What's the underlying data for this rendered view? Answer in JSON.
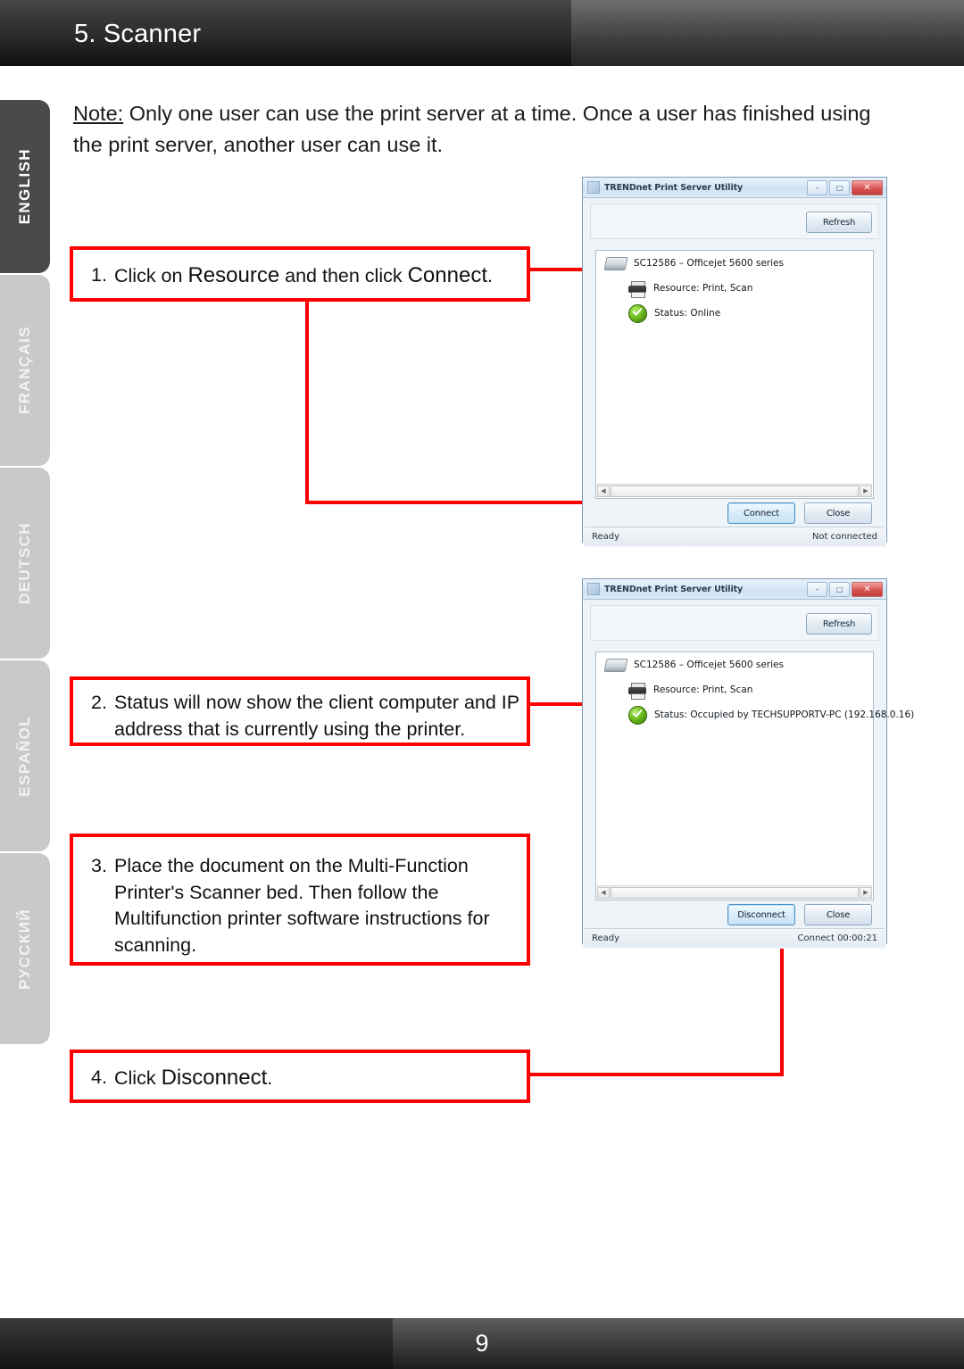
{
  "header": {
    "title": "5. Scanner"
  },
  "footer": {
    "page_number": "9"
  },
  "sidebar": {
    "items": [
      {
        "label": "ENGLISH",
        "active": true
      },
      {
        "label": "FRANÇAIS",
        "active": false
      },
      {
        "label": "DEUTSCH",
        "active": false
      },
      {
        "label": "ESPAÑOL",
        "active": false
      },
      {
        "label": "РУССКИЙ",
        "active": false
      }
    ]
  },
  "note": {
    "label": "Note:",
    "line1": " Only one user can use the print server at a time.  Once a user has finished using",
    "line2": "the print server, another user can use it."
  },
  "steps": [
    {
      "number": "1.",
      "pre": "Click on ",
      "emphasis1": "Resource",
      "mid": " and then click ",
      "emphasis2": "Connect",
      "post": "."
    },
    {
      "number": "2.",
      "line1": "Status will now show the client computer and IP",
      "line2": "address that is currently using the printer."
    },
    {
      "number": "3.",
      "line1": "Place the document on the Multi-Function",
      "line2": "Printer's Scanner bed. Then follow the",
      "line3": "Multifunction printer software instructions for",
      "line4": "scanning."
    },
    {
      "number": "4.",
      "pre": "Click ",
      "emphasis1": "Disconnect",
      "post": "."
    }
  ],
  "windows": [
    {
      "id": "window-connect",
      "title": "TRENDnet Print Server Utility",
      "title_icon": "app-icon",
      "caption_buttons": [
        {
          "name": "minimize-button",
          "glyph": "–"
        },
        {
          "name": "maximize-button",
          "glyph": "□"
        },
        {
          "name": "close-button",
          "glyph": "✕"
        }
      ],
      "refresh_label": "Refresh",
      "tree": [
        {
          "icon": "print-server-icon",
          "label": "SC12586 – Officejet 5600 series"
        },
        {
          "icon": "printer-icon",
          "label": "Resource: Print, Scan"
        },
        {
          "icon": "status-ok-icon",
          "label": "Status: Online"
        }
      ],
      "buttons": [
        {
          "name": "connect-button",
          "label": "Connect",
          "primary": true
        },
        {
          "name": "close-button",
          "label": "Close",
          "primary": false
        }
      ],
      "status_left": "Ready",
      "status_right": "Not connected"
    },
    {
      "id": "window-disconnect",
      "title": "TRENDnet Print Server Utility",
      "title_icon": "app-icon",
      "caption_buttons": [
        {
          "name": "minimize-button",
          "glyph": "–"
        },
        {
          "name": "maximize-button",
          "glyph": "□"
        },
        {
          "name": "close-button",
          "glyph": "✕"
        }
      ],
      "refresh_label": "Refresh",
      "tree": [
        {
          "icon": "print-server-icon",
          "label": "SC12586 – Officejet 5600 series"
        },
        {
          "icon": "printer-icon",
          "label": "Resource: Print, Scan"
        },
        {
          "icon": "status-ok-icon",
          "label": "Status: Occupied by TECHSUPPORTV-PC (192.168.0.16)"
        }
      ],
      "buttons": [
        {
          "name": "disconnect-button",
          "label": "Disconnect",
          "primary": true
        },
        {
          "name": "close-button",
          "label": "Close",
          "primary": false
        }
      ],
      "status_left": "Ready",
      "status_right": "Connect 00:00:21"
    }
  ],
  "colors": {
    "callout_border": "#ff0000",
    "connector": "#ff0000",
    "header_bar": "#2b2b2b",
    "active_tab": "#4a4a4a",
    "inactive_tab": "#c9c9c9"
  }
}
